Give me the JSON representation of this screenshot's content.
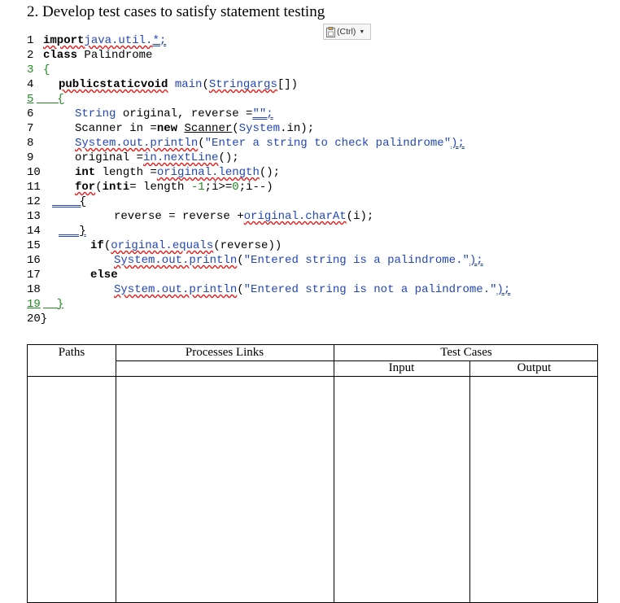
{
  "question": "2. Develop test cases to satisfy statement testing",
  "ctrl_label": "(Ctrl)",
  "code_lines": [
    {
      "num": "1",
      "text": "importjava.util.*;"
    },
    {
      "num": "2",
      "text": "class Palindrome"
    },
    {
      "num": "3",
      "text": "{"
    },
    {
      "num": "4",
      "text": "publicstaticvoid main(Stringargs[])"
    },
    {
      "num": "5",
      "text": "{"
    },
    {
      "num": "6",
      "text": "String original, reverse =\"\";"
    },
    {
      "num": "7",
      "text": "Scanner in =new Scanner(System.in);"
    },
    {
      "num": "8",
      "text": "System.out.println(\"Enter a string to check palindrome\");"
    },
    {
      "num": "9",
      "text": "original =in.nextLine();"
    },
    {
      "num": "10",
      "text": "int length =original.length();"
    },
    {
      "num": "11",
      "text": "for(inti= length -1;i>=0;i--)"
    },
    {
      "num": "12",
      "text": "{"
    },
    {
      "num": "13",
      "text": "reverse = reverse +original.charAt(i);"
    },
    {
      "num": "14",
      "text": "}"
    },
    {
      "num": "15",
      "text": "if(original.equals(reverse))"
    },
    {
      "num": "16",
      "text": "System.out.println(\"Entered string is a palindrome.\");"
    },
    {
      "num": "17",
      "text": "else"
    },
    {
      "num": "18",
      "text": "System.out.println(\"Entered string is not a palindrome.\");"
    },
    {
      "num": "19",
      "text": "}"
    },
    {
      "num": "20",
      "text": "}"
    }
  ],
  "table": {
    "col_paths": "Paths",
    "col_processes": "Processes Links",
    "col_testcases": "Test Cases",
    "col_input": "Input",
    "col_output": "Output"
  }
}
